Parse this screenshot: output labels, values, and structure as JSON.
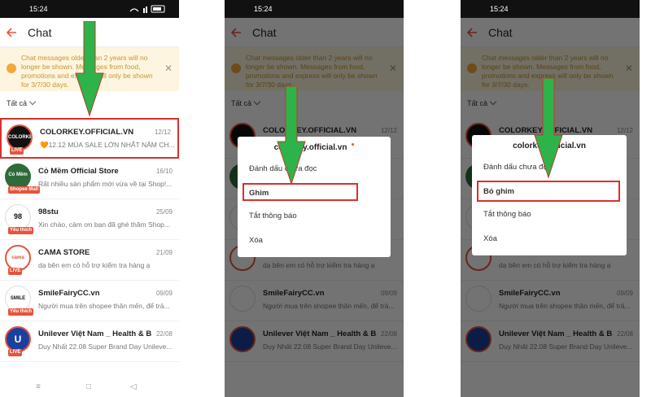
{
  "colors": {
    "accent": "#e8533b",
    "highlight": "#d9302b",
    "arrow": "#2db34a",
    "notice_bg": "#fdf5df"
  },
  "status": {
    "time": "15:24"
  },
  "header": {
    "title": "Chat"
  },
  "notice": {
    "text": "Chat messages older than 2 years will no longer be shown. Messages from food, promotions and express will only be shown for 3/7/30 days."
  },
  "filter": {
    "label": "Tất cả"
  },
  "chats": [
    {
      "name": "COLORKEY.OFFICIAL.VN",
      "date": "12/12",
      "preview": "🧡12.12 MÙA SALE LỚN NHẤT NĂM CH...",
      "avatar": "COLORKEY",
      "tag": "LIVE"
    },
    {
      "name": "Cỏ Mềm Official Store",
      "date": "16/10",
      "preview": "Rất nhiều sản phẩm mới vừa về tại Shop!...",
      "avatar": "Cỏ Mềm",
      "tag": "Shopee Mall"
    },
    {
      "name": "98stu",
      "date": "25/09",
      "preview": "Xin chào, cảm ơn bạn đã ghé thăm Shop...",
      "avatar": "98",
      "tag": "Yêu thích"
    },
    {
      "name": "CAMA STORE",
      "date": "21/09",
      "preview": "dạ bên em có hỗ trợ kiểm tra hàng ạ",
      "avatar": "cama",
      "tag": "LIVE"
    },
    {
      "name": "SmileFairyCC.vn",
      "date": "09/09",
      "preview": "Người mua trên shopee thân mến, để trả...",
      "avatar": "SMILE",
      "tag": "Yêu thích"
    },
    {
      "name": "Unilever Việt Nam _ Health & B...",
      "date": "22/08",
      "preview": "Duy Nhất 22.08 Super Brand Day Unileve...",
      "avatar": "U",
      "tag": "LIVE"
    }
  ],
  "dialog_pin": {
    "title": "colorkey.official.vn",
    "items": [
      "Đánh dấu chưa đọc",
      "Ghim",
      "Tắt thông báo",
      "Xóa"
    ]
  },
  "dialog_unpin": {
    "title": "colorkey.official.vn",
    "items": [
      "Đánh dấu chưa đọc",
      "Bỏ ghim",
      "Tắt thông báo",
      "Xóa"
    ]
  },
  "navbar": {
    "items": [
      "≡",
      "□",
      "◁"
    ]
  }
}
